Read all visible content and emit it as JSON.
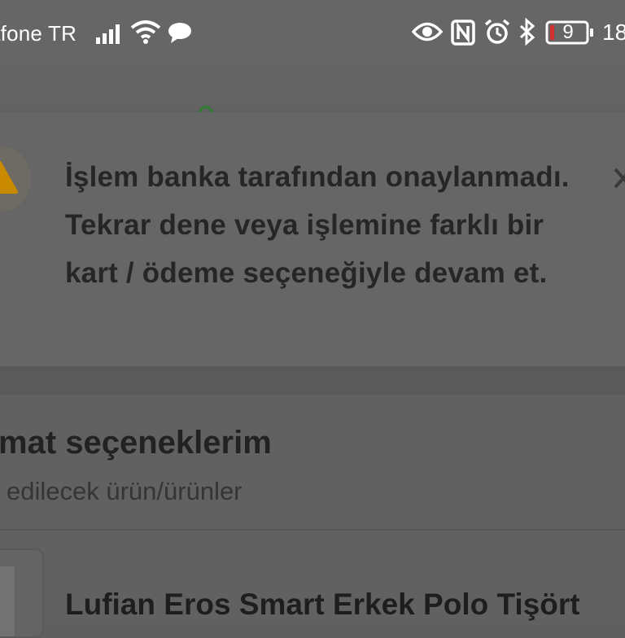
{
  "status_bar": {
    "carrier": "afone TR",
    "battery_level": "9",
    "time": "18",
    "icons": [
      "signal-icon",
      "wifi-icon",
      "chat-bubble-icon",
      "eye-icon",
      "nfc-icon",
      "alarm-icon",
      "bluetooth-icon",
      "battery-icon"
    ]
  },
  "alert": {
    "message": "İşlem banka tarafından onaylanmadı. Tekrar dene veya işlemine farklı bir kart / ödeme seçeneğiyle devam et.",
    "icon": "warning-icon",
    "close_icon": "close-icon",
    "colors": {
      "warning": "#c98a00",
      "overlay": "#666666"
    }
  },
  "section": {
    "title": "mat seçeneklerim",
    "subtitle": "edilecek ürün/ürünler"
  },
  "product": {
    "name": "Lufian Eros Smart Erkek Polo Tişört"
  }
}
